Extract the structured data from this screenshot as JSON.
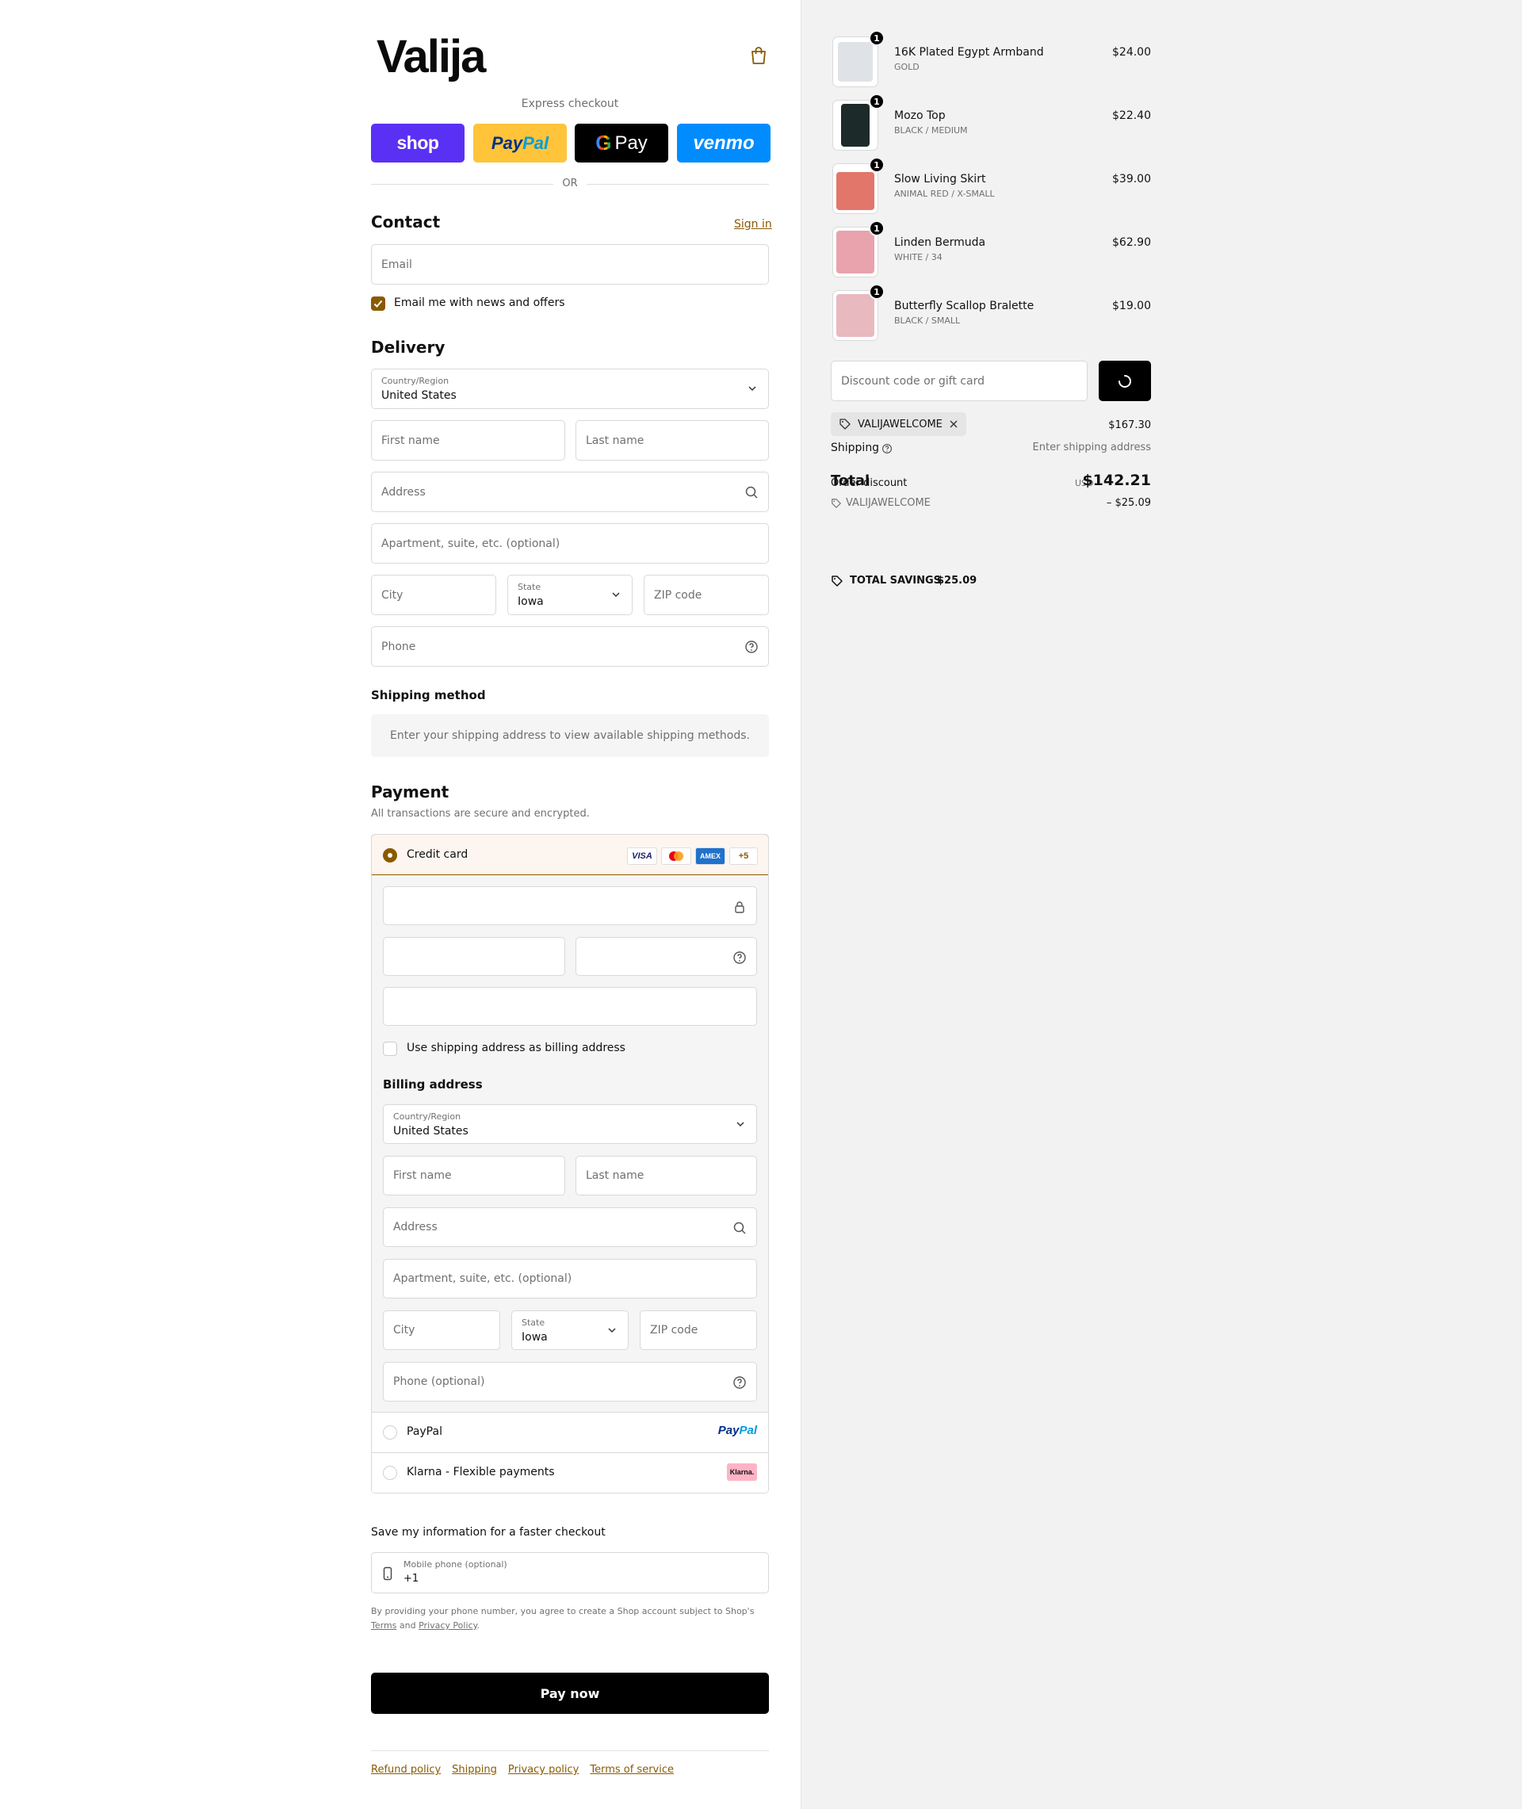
{
  "brand": {
    "logo": "Valija"
  },
  "express": {
    "label": "Express checkout",
    "shop": "shop",
    "paypal_a": "Pay",
    "paypal_b": "Pal",
    "gpay": "Pay",
    "venmo": "venmo",
    "or": "OR"
  },
  "contact": {
    "title": "Contact",
    "sign_in": "Sign in",
    "email_placeholder": "Email",
    "news_label": "Email me with news and offers"
  },
  "delivery": {
    "title": "Delivery",
    "country_label": "Country/Region",
    "country": "United States",
    "first_name": "First name",
    "last_name": "Last name",
    "address": "Address",
    "apartment": "Apartment, suite, etc. (optional)",
    "city": "City",
    "state_label": "State",
    "state": "Iowa",
    "zip": "ZIP code",
    "phone": "Phone"
  },
  "shipping_method": {
    "title": "Shipping method",
    "message": "Enter your shipping address to view available shipping methods."
  },
  "payment": {
    "title": "Payment",
    "subtitle": "All transactions are secure and encrypted.",
    "credit_card": "Credit card",
    "cards": [
      "VISA",
      "AMEX",
      "+5"
    ],
    "use_shipping": "Use shipping address as billing address",
    "billing_title": "Billing address",
    "billing": {
      "country_label": "Country/Region",
      "country": "United States",
      "first_name": "First name",
      "last_name": "Last name",
      "address": "Address",
      "apartment": "Apartment, suite, etc. (optional)",
      "city": "City",
      "state_label": "State",
      "state": "Iowa",
      "zip": "ZIP code",
      "phone": "Phone (optional)"
    },
    "paypal": "PayPal",
    "paypal_logo_a": "Pay",
    "paypal_logo_b": "Pal",
    "klarna": "Klarna - Flexible payments",
    "klarna_logo": "Klarna."
  },
  "save_info": {
    "title": "Save my information for a faster checkout",
    "mobile_label": "Mobile phone (optional)",
    "mobile_value": "+1",
    "legal_1": "By providing your phone number, you agree to create a Shop account subject to Shop's",
    "terms": "Terms",
    "and": "and",
    "privacy": "Privacy Policy",
    "dot": "."
  },
  "pay_now": "Pay now",
  "footer": [
    "Refund policy",
    "Shipping",
    "Privacy policy",
    "Terms of service"
  ],
  "cart": {
    "items": [
      {
        "name": "16K Plated Egypt Armband",
        "variant": "GOLD",
        "price": "$24.00",
        "qty": "1",
        "color": "#dfe3e8"
      },
      {
        "name": "Mozo Top",
        "variant": "BLACK / MEDIUM",
        "price": "$22.40",
        "qty": "1",
        "color": "#1c2a2a"
      },
      {
        "name": "Slow Living Skirt",
        "variant": "ANIMAL RED / X-SMALL",
        "price": "$39.00",
        "qty": "1",
        "color": "#e2766a"
      },
      {
        "name": "Linden Bermuda",
        "variant": "WHITE / 34",
        "price": "$62.90",
        "qty": "1",
        "color": "#e8a3ad"
      },
      {
        "name": "Butterfly Scallop Bralette",
        "variant": "BLACK / SMALL",
        "price": "$19.00",
        "qty": "1",
        "color": "#e9b9c0"
      }
    ],
    "discount_placeholder": "Discount code or gift card",
    "applied_code": "VALIJAWELCOME",
    "subtotal": "$167.30",
    "shipping_label": "Shipping",
    "shipping_value": "Enter shipping address",
    "total_label": "Total",
    "order_discount_label": "Order discount",
    "currency": "USD",
    "total": "$142.21",
    "discount_code": "VALIJAWELCOME",
    "discount_value": "– $25.09",
    "savings_label": "TOTAL SAVINGS",
    "savings_value": "$25.09"
  },
  "colors": {
    "accent": "#8a5a00",
    "shop": "#5a31f4",
    "paypal": "#ffc439",
    "venmo": "#008cff"
  }
}
